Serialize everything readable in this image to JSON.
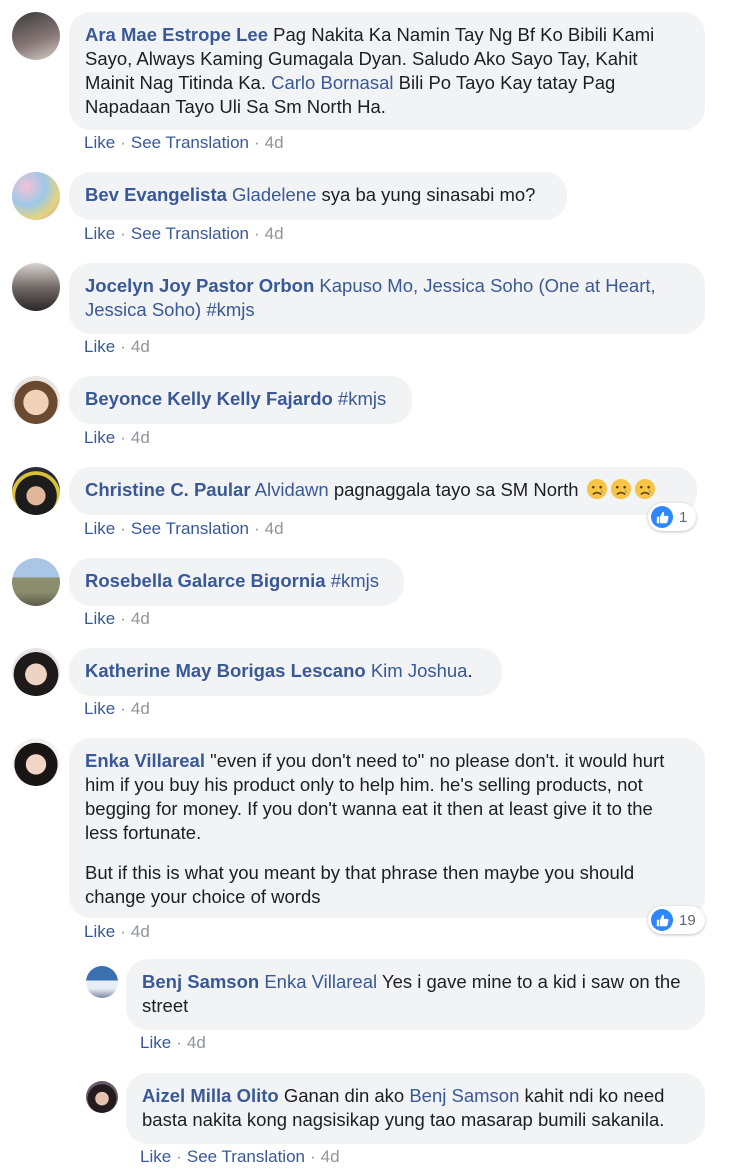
{
  "comments": [
    {
      "author": "Ara Mae Estrope Lee",
      "text1": " Pag Nakita Ka Namin Tay Ng Bf Ko Bibili Kami Sayo, Always Kaming Gumagala Dyan. Saludo Ako Sayo Tay, Kahit Mainit Nag Titinda Ka. ",
      "mention": "Carlo Bornasal",
      "text2": " Bili Po Tayo Kay tatay Pag Napadaan Tayo Uli Sa Sm North Ha.",
      "like": "Like",
      "translate": "See Translation",
      "time": "4d"
    },
    {
      "author": "Bev Evangelista",
      "mention": "Gladelene",
      "text": " sya ba yung sinasabi mo?",
      "like": "Like",
      "translate": "See Translation",
      "time": "4d"
    },
    {
      "author": "Jocelyn Joy Pastor Orbon",
      "mention": " Kapuso Mo, Jessica Soho (One at Heart, Jessica Soho) #kmjs",
      "like": "Like",
      "time": "4d"
    },
    {
      "author": "Beyonce Kelly Kelly Fajardo",
      "tag": " #kmjs",
      "like": "Like",
      "time": "4d"
    },
    {
      "author": "Christine C. Paular",
      "mention": "Alvidawn",
      "text": " pagnaggala tayo sa SM North ",
      "like": "Like",
      "translate": "See Translation",
      "time": "4d",
      "reaction_count": "1"
    },
    {
      "author": "Rosebella Galarce Bigornia",
      "tag": " #kmjs",
      "like": "Like",
      "time": "4d"
    },
    {
      "author": "Katherine May Borigas Lescano",
      "mention": "Kim Joshua",
      "text": ".",
      "like": "Like",
      "time": "4d"
    },
    {
      "author": "Enka Villareal",
      "text1": " \"even if you don't need to\" no please don't. it would hurt him if you buy his product only to help him. he's selling products, not begging for money. If you don't wanna eat it then at least give it to the less fortunate.",
      "text2": "But if this is what you meant by that phrase then maybe you should change your choice of words",
      "like": "Like",
      "time": "4d",
      "reaction_count": "19"
    }
  ],
  "replies": [
    {
      "author": "Benj Samson",
      "mention": "Enka Villareal",
      "text": " Yes i gave mine to a kid i saw on the street",
      "like": "Like",
      "time": "4d"
    },
    {
      "author": "Aizel Milla Olito",
      "text1": " Ganan din ako ",
      "mention": "Benj Samson",
      "text2": " kahit ndi ko need basta nakita kong nagsisikap yung tao masarap bumili sakanila.",
      "like": "Like",
      "translate": "See Translation",
      "time": "4d"
    }
  ]
}
